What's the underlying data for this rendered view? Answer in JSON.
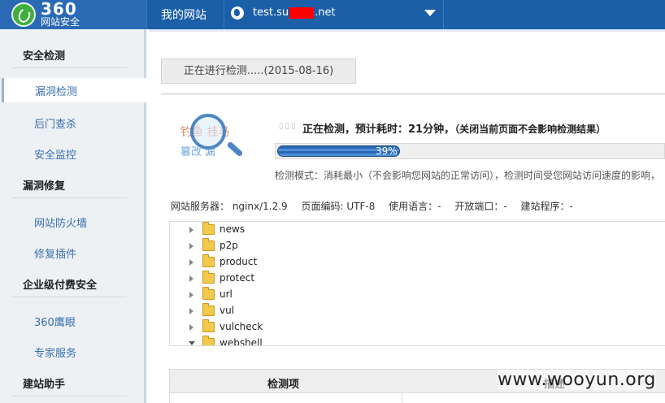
{
  "header": {
    "logo_number": "360",
    "logo_text": "网站安全",
    "nav_title": "我的网站",
    "site_prefix": "test.su",
    "site_suffix": ".net"
  },
  "sidebar": {
    "groups": [
      {
        "title": "安全检测",
        "items": [
          "漏洞检测",
          "后门查杀",
          "安全监控"
        ]
      },
      {
        "title": "漏洞修复",
        "items": [
          "网站防火墙",
          "修复插件"
        ]
      },
      {
        "title": "企业级付费安全",
        "items": [
          "360鹰眼",
          "专家服务"
        ]
      },
      {
        "title": "建站助手",
        "items": []
      }
    ],
    "active_item": "漏洞检测"
  },
  "scan": {
    "status_button": "正在进行检测.....(2015-08-16)",
    "illus_text_1": "钓鱼 挂马",
    "illus_text_2": "篡改 漏",
    "dots": "▯▯▯",
    "message": "正在检测，预计耗时：21分钟，",
    "message_note": "（关闭当前页面不会影响检测结果）",
    "progress_percent": 39,
    "progress_label": "39%",
    "mode_text": "检测模式：消耗最小（不会影响您网站的正常访问），检测时间受您网站访问速度的影响，"
  },
  "server_info": {
    "server": "网站服务器： nginx/1.2.9",
    "encoding": "页面编码: UTF-8",
    "language": "使用语言：-",
    "ports": "开放端口：-",
    "program": "建站程序：-"
  },
  "tree": {
    "folders": [
      {
        "name": "news",
        "expanded": false
      },
      {
        "name": "p2p",
        "expanded": false
      },
      {
        "name": "product",
        "expanded": false
      },
      {
        "name": "protect",
        "expanded": false
      },
      {
        "name": "url",
        "expanded": false
      },
      {
        "name": "vul",
        "expanded": false
      },
      {
        "name": "vulcheck",
        "expanded": false
      },
      {
        "name": "webshell",
        "expanded": true
      }
    ]
  },
  "results_table": {
    "col1": "检测项",
    "col2": "描述"
  },
  "watermark": "www.wooyun.org",
  "colors": {
    "topbar": "#1b5fa8",
    "progress": "#2c6fba",
    "redaction": "#ff0000",
    "sidebar_link": "#3a6fb0"
  }
}
